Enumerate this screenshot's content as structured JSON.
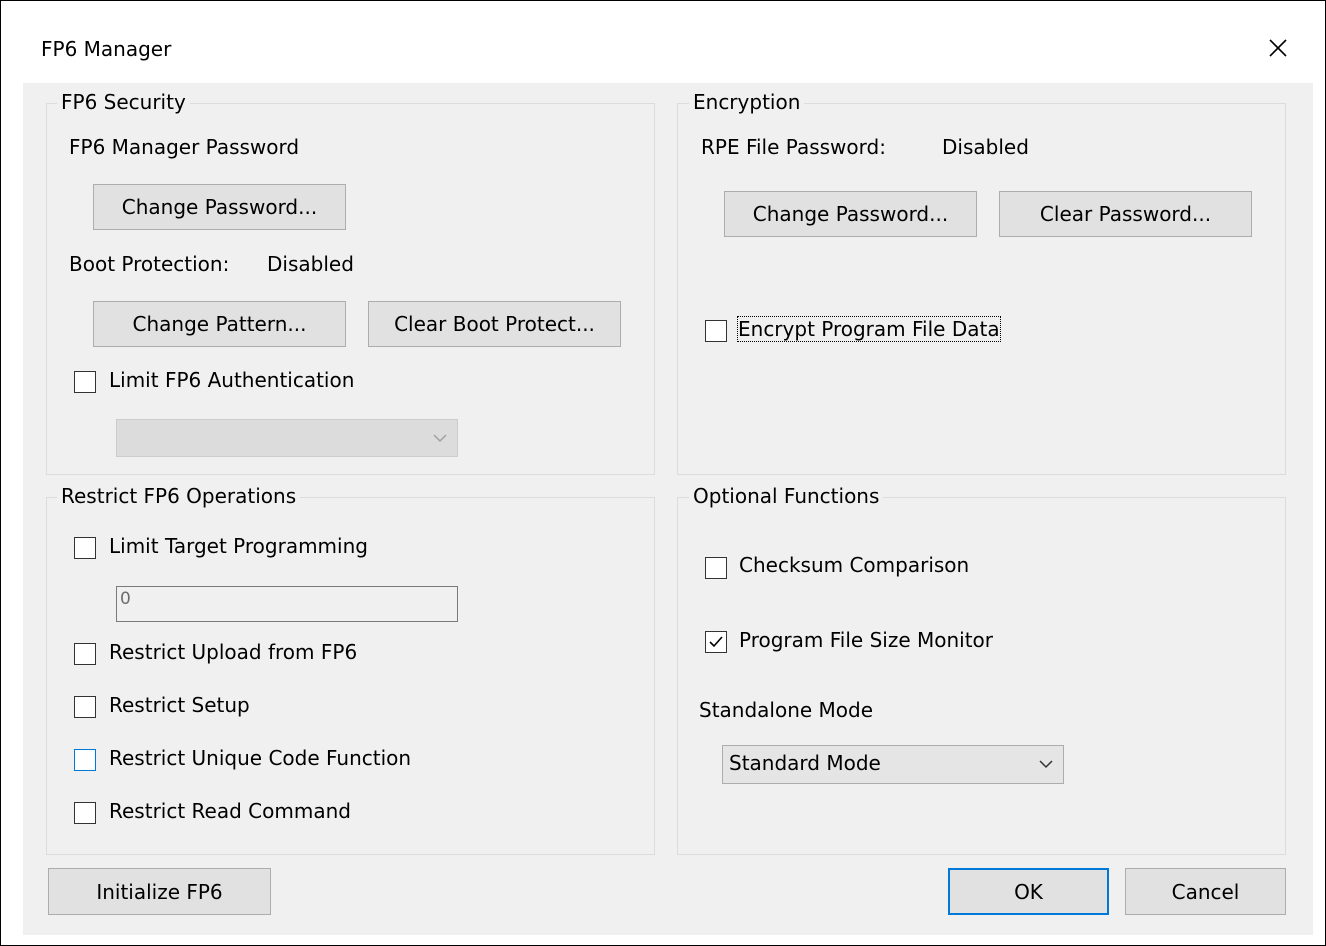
{
  "window": {
    "title": "FP6 Manager",
    "close_icon": "close-icon"
  },
  "security": {
    "legend": "FP6 Security",
    "manager_password_label": "FP6 Manager Password",
    "change_password_button": "Change Password...",
    "boot_protection_label": "Boot Protection:",
    "boot_protection_value": "Disabled",
    "change_pattern_button": "Change Pattern...",
    "clear_boot_protect_button": "Clear Boot Protect...",
    "limit_auth_label": "Limit FP6 Authentication",
    "limit_auth_checked": false,
    "auth_dropdown_value": ""
  },
  "encryption": {
    "legend": "Encryption",
    "rpe_password_label": "RPE File Password:",
    "rpe_password_value": "Disabled",
    "change_password_button": "Change Password...",
    "clear_password_button": "Clear Password...",
    "encrypt_label": "Encrypt Program File Data",
    "encrypt_checked": false
  },
  "restrict": {
    "legend": "Restrict FP6 Operations",
    "limit_target_label": "Limit Target Programming",
    "limit_target_checked": false,
    "limit_target_count": "0",
    "upload_label": "Restrict Upload from FP6",
    "upload_checked": false,
    "setup_label": "Restrict Setup",
    "setup_checked": false,
    "unique_code_label": "Restrict Unique Code Function",
    "unique_code_checked": false,
    "read_command_label": "Restrict Read Command",
    "read_command_checked": false
  },
  "optional": {
    "legend": "Optional Functions",
    "checksum_label": "Checksum Comparison",
    "checksum_checked": false,
    "size_monitor_label": "Program File Size Monitor",
    "size_monitor_checked": true,
    "standalone_label": "Standalone Mode",
    "standalone_value": "Standard Mode"
  },
  "footer": {
    "initialize_button": "Initialize FP6",
    "ok_button": "OK",
    "cancel_button": "Cancel"
  },
  "colors": {
    "dialog_bg": "#f0f0f0",
    "button_bg": "#e1e1e1",
    "accent": "#0078d7"
  }
}
